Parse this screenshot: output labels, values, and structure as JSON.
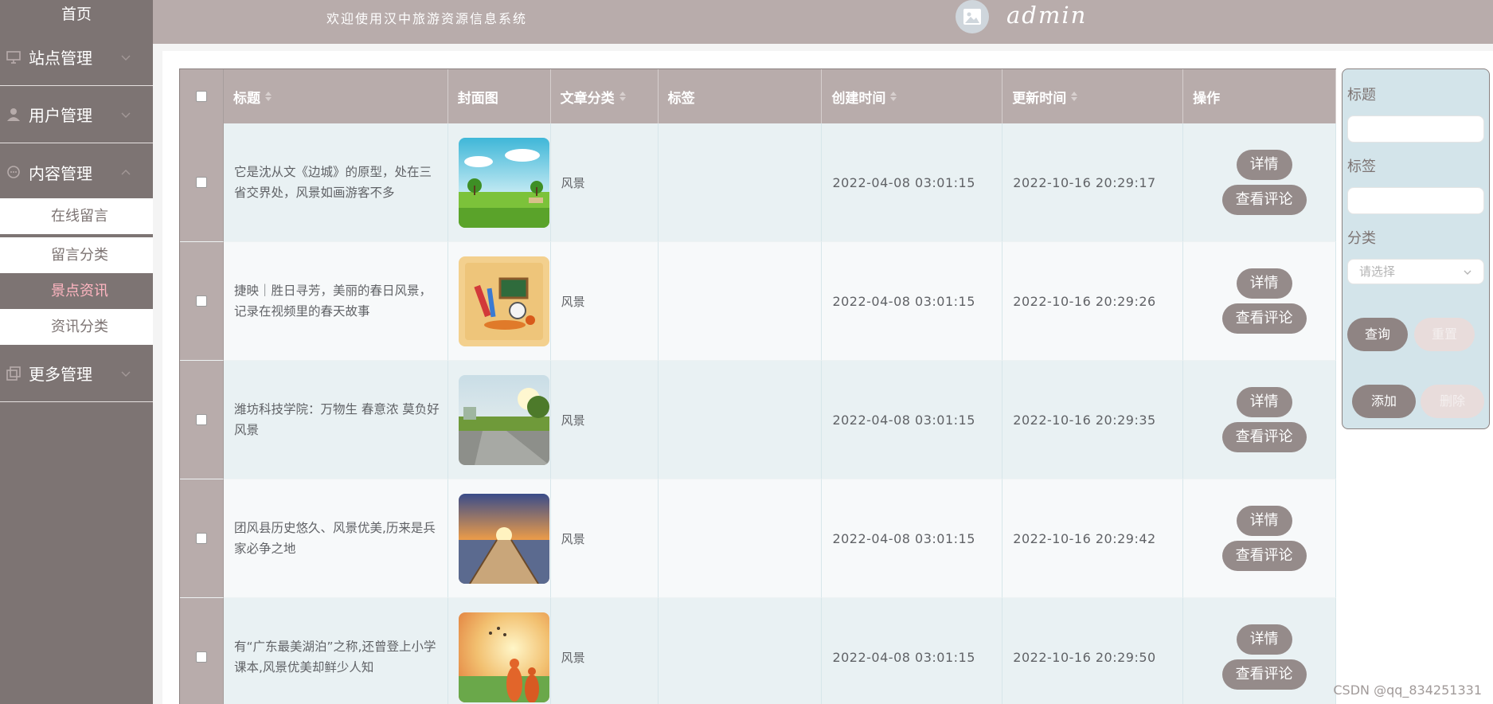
{
  "sidebar": {
    "home": "首页",
    "menus": [
      {
        "label": "站点管理",
        "icon": "monitor-icon"
      },
      {
        "label": "用户管理",
        "icon": "user-icon"
      },
      {
        "label": "内容管理",
        "icon": "chat-icon"
      },
      {
        "label": "更多管理",
        "icon": "copy-icon"
      }
    ],
    "submenus": [
      {
        "label": "在线留言",
        "active": false
      },
      {
        "label": "留言分类",
        "active": false
      },
      {
        "label": "景点资讯",
        "active": true
      },
      {
        "label": "资讯分类",
        "active": false
      }
    ]
  },
  "header": {
    "welcome": "欢迎使用汉中旅游资源信息系统",
    "avatar_icon": "image-icon",
    "username": "admin"
  },
  "table": {
    "columns": [
      "标题",
      "封面图",
      "文章分类",
      "标签",
      "创建时间",
      "更新时间",
      "操作"
    ],
    "rows": [
      {
        "title": "它是沈从文《边城》的原型，处在三省交界处，风景如画游客不多",
        "category": "风景",
        "tag": "",
        "created": "2022-04-08 03:01:15",
        "updated": "2022-10-16 20:29:17"
      },
      {
        "title": "捷映｜胜日寻芳，美丽的春日风景，记录在视频里的春天故事",
        "category": "风景",
        "tag": "",
        "created": "2022-04-08 03:01:15",
        "updated": "2022-10-16 20:29:26"
      },
      {
        "title": "潍坊科技学院：万物生 春意浓 莫负好风景",
        "category": "风景",
        "tag": "",
        "created": "2022-04-08 03:01:15",
        "updated": "2022-10-16 20:29:35"
      },
      {
        "title": "团风县历史悠久、风景优美,历来是兵家必争之地",
        "category": "风景",
        "tag": "",
        "created": "2022-04-08 03:01:15",
        "updated": "2022-10-16 20:29:42"
      },
      {
        "title": "有“广东最美湖泊”之称,还曾登上小学课本,风景优美却鲜少人知",
        "category": "风景",
        "tag": "",
        "created": "2022-04-08 03:01:15",
        "updated": "2022-10-16 20:29:50"
      }
    ],
    "detail_label": "详情",
    "comment_label": "查看评论"
  },
  "search": {
    "title_label": "标题",
    "tag_label": "标签",
    "category_label": "分类",
    "category_placeholder": "请选择",
    "query_label": "查询",
    "reset_label": "重置",
    "add_label": "添加",
    "delete_label": "删除"
  },
  "watermark": "CSDN @qq_834251331"
}
